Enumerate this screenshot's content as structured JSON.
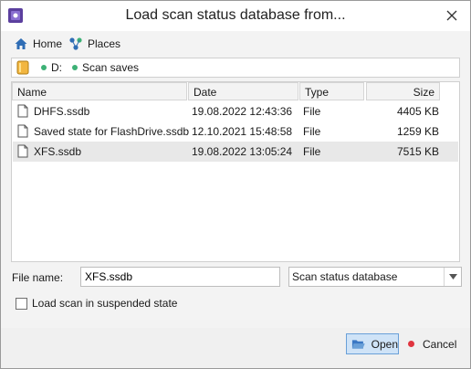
{
  "window": {
    "title": "Load scan status database from..."
  },
  "toolbar": {
    "home_label": "Home",
    "places_label": "Places"
  },
  "path": {
    "crumbs": [
      "D:",
      "Scan saves"
    ]
  },
  "files": {
    "columns": [
      "Name",
      "Date",
      "Type",
      "Size"
    ],
    "rows": [
      {
        "name": "DHFS.ssdb",
        "date": "19.08.2022 12:43:36",
        "type": "File",
        "size": "4405 KB",
        "selected": false
      },
      {
        "name": "Saved state for FlashDrive.ssdb",
        "date": "12.10.2021 15:48:58",
        "type": "File",
        "size": "1259 KB",
        "selected": false
      },
      {
        "name": "XFS.ssdb",
        "date": "19.08.2022 13:05:24",
        "type": "File",
        "size": "7515 KB",
        "selected": true
      }
    ]
  },
  "form": {
    "filename_label": "File name:",
    "filename_value": "XFS.ssdb",
    "filetype_value": "Scan status database",
    "checkbox_label": "Load scan in suspended state",
    "checkbox_checked": false
  },
  "buttons": {
    "open_label": "Open",
    "cancel_label": "Cancel"
  },
  "colors": {
    "accent": "#6aa0d8",
    "selected_row": "#e8e8e8",
    "dot_green": "#3db176",
    "cancel_red": "#e0353f"
  }
}
